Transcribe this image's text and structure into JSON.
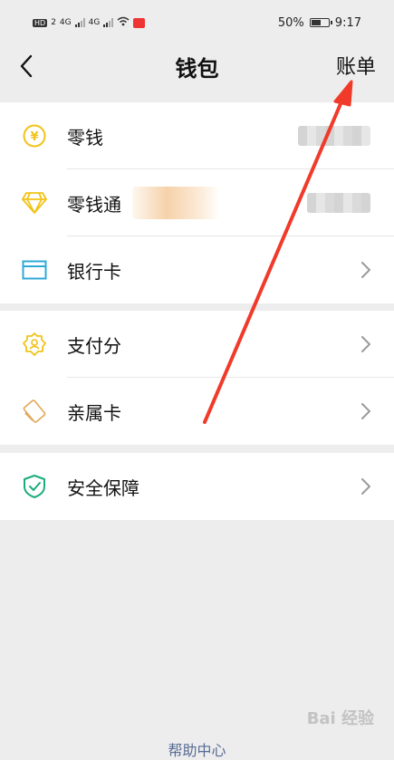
{
  "status_bar": {
    "left_badges": [
      "HD",
      "2",
      "4G",
      "4G"
    ],
    "battery": "50%",
    "time": "9:17"
  },
  "navbar": {
    "back_icon": "chevron-left-icon",
    "title": "钱包",
    "action_label": "账单"
  },
  "sections": [
    {
      "items": [
        {
          "label": "零钱",
          "icon": "yuan-coin-icon",
          "color": "#f2c318",
          "value_hidden": true
        },
        {
          "label": "零钱通",
          "icon": "diamond-icon",
          "color": "#f2c318",
          "value_hidden": true
        },
        {
          "label": "银行卡",
          "icon": "bank-card-icon",
          "color": "#2fa9d8",
          "chevron": true
        }
      ]
    },
    {
      "items": [
        {
          "label": "支付分",
          "icon": "pay-score-icon",
          "color": "#f2c318",
          "chevron": true
        },
        {
          "label": "亲属卡",
          "icon": "family-card-icon",
          "color": "#e3a95c",
          "chevron": true
        }
      ]
    },
    {
      "items": [
        {
          "label": "安全保障",
          "icon": "shield-check-icon",
          "color": "#1aad7a",
          "chevron": true
        }
      ]
    }
  ],
  "footer": {
    "help_link": "帮助中心"
  },
  "watermark": "Bai 经验",
  "annotation": {
    "arrow_color": "#f03a2a"
  }
}
